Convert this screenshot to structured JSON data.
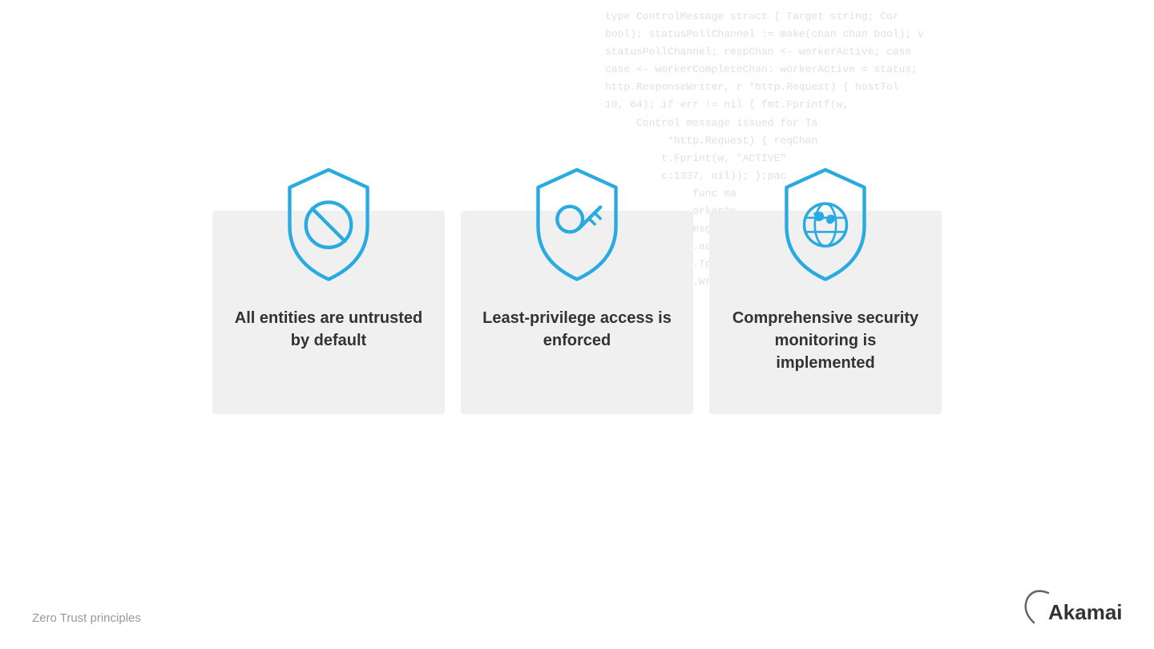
{
  "background": {
    "code_lines": [
      "type ControlMessage struct { Target string; Cor",
      "bool); statusPollChannel := make(chan chan bool); v",
      "statusPollChannel; respChan <- workerActive; case",
      "case <- workerCompleteChan: workerActive = status;",
      "http.ResponseWriter, r *http.Request) { hostTol",
      "10, 64); if err != nil { fmt.Fprintf(w,",
      "     Control message issued for Ta",
      "     *http.Request) { reqChan",
      "    t.Fprint(w, \"ACTIVE\"",
      "    c:1337, nil)); };pac",
      "func ma",
      "orkerAp",
      "msg := s",
      ".admin(",
      ".Tokens",
      ".Write("
    ]
  },
  "cards": [
    {
      "id": "untrusted",
      "icon": "ban-icon",
      "text": "All entities are untrusted by default"
    },
    {
      "id": "least-privilege",
      "icon": "key-icon",
      "text": "Least-privilege access is enforced"
    },
    {
      "id": "monitoring",
      "icon": "globe-icon",
      "text": "Comprehensive security monitoring is implemented"
    }
  ],
  "footer": {
    "label": "Zero Trust principles"
  },
  "brand": {
    "name": "Akamai"
  }
}
